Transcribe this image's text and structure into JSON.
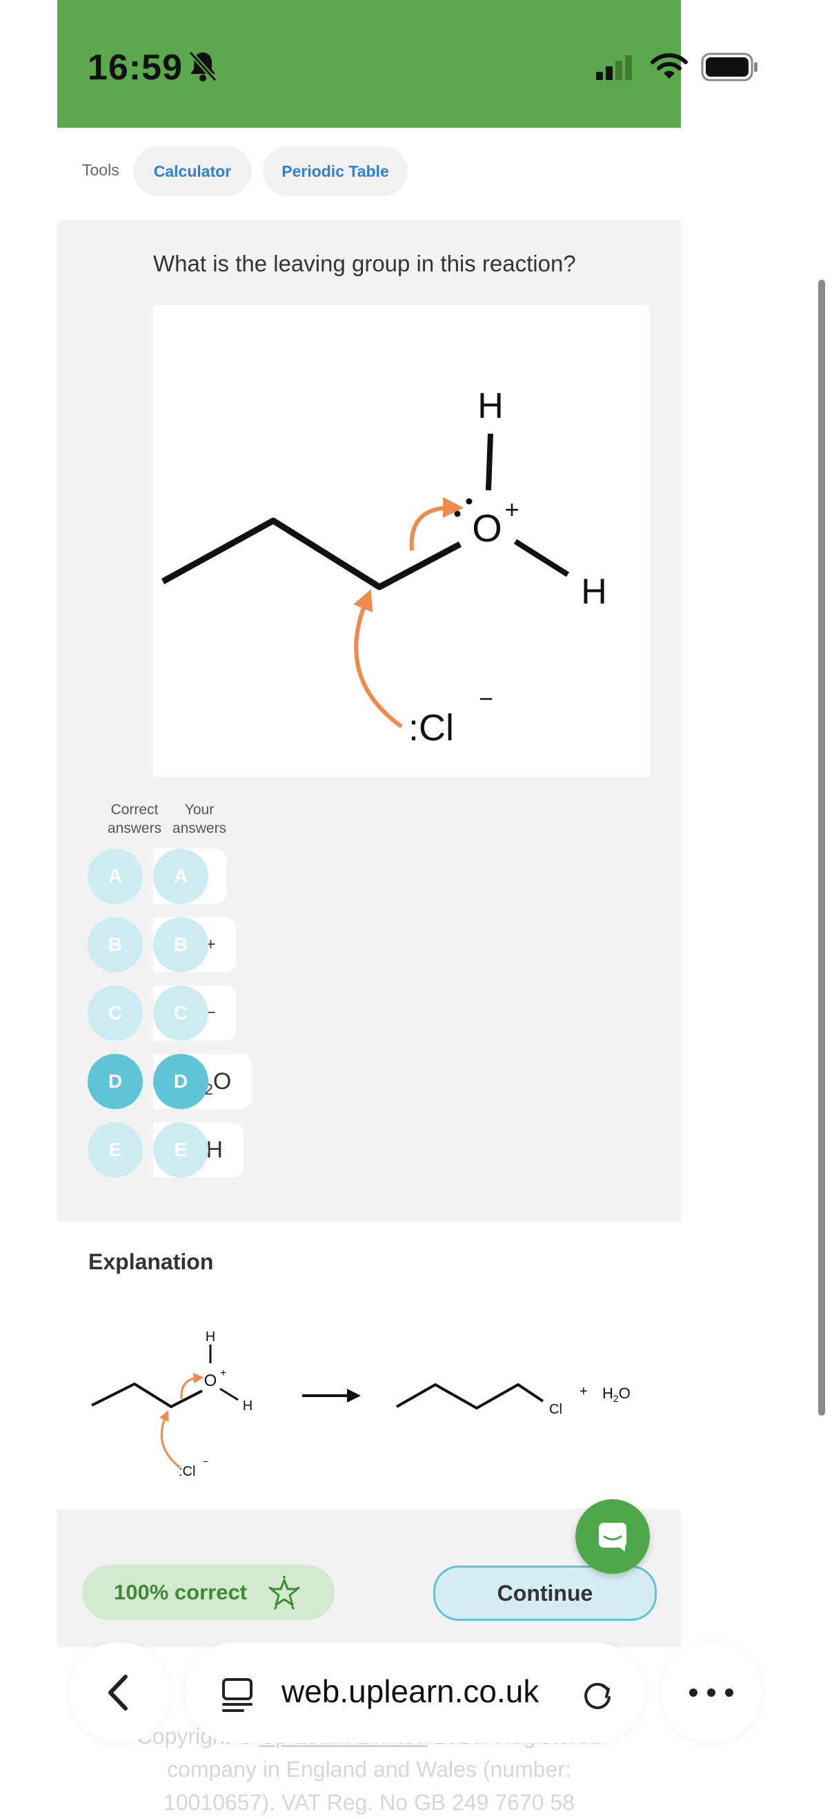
{
  "status": {
    "time": "16:59",
    "icons": [
      "silent-bell-icon",
      "signal-icon",
      "wifi-icon",
      "battery-icon"
    ]
  },
  "tools": {
    "label": "Tools",
    "calculator": "Calculator",
    "periodic_table": "Periodic Table"
  },
  "question": {
    "text": "What is the leaving group in this reaction?",
    "diagram_labels": {
      "h_top": "H",
      "h_right": "H",
      "oxygen": "O",
      "plus": "+",
      "chloride": ":Cl",
      "minus": "−"
    }
  },
  "answers": {
    "header_correct": [
      "Correct",
      "answers"
    ],
    "header_yours": [
      "Your",
      "answers"
    ],
    "options": [
      {
        "letter": "A",
        "text": "O",
        "selected": false
      },
      {
        "letter": "B",
        "text": "O",
        "sup": "+",
        "selected": false
      },
      {
        "letter": "C",
        "text": "O",
        "sup": "−",
        "selected": false
      },
      {
        "letter": "D",
        "text": "H",
        "sub": "2",
        "tail": "O",
        "selected": true
      },
      {
        "letter": "E",
        "text": "OH",
        "selected": false
      }
    ]
  },
  "explanation": {
    "title": "Explanation",
    "labels": {
      "h1": "H",
      "h2": "H",
      "o": "O",
      "plus": "+",
      "cl_ion": ":Cl",
      "cl_minus": "−",
      "cl_product": "Cl",
      "plus_sign": "+",
      "water_h": "H",
      "water_2": "2",
      "water_o": "O"
    }
  },
  "footer": {
    "score": "100% correct",
    "continue": "Continue"
  },
  "copyright": {
    "line1_pre": "Copyright © ",
    "line1_link": "Up Learn Limited",
    "line1_post": " 2020. Registered",
    "line2": "company in England and Wales (number:",
    "line3": "10010657). VAT Reg. No GB 249 7670 58"
  },
  "browser": {
    "url": "web.uplearn.co.uk"
  },
  "colors": {
    "brand_green": "#5ca84c",
    "accent_blue": "#5ec4d6",
    "arrow_orange": "#f0894a",
    "link_blue": "#2f7fd8"
  }
}
